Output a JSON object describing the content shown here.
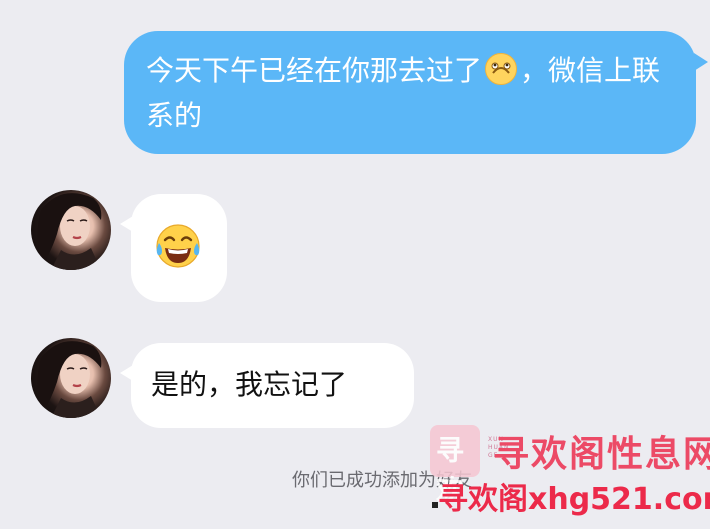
{
  "chat": {
    "outgoing": {
      "text_part1": "今天下午已经在你那去过了",
      "emoji": "upside-down-face",
      "text_part2": "，微信上联系的",
      "bubble_color": "#5bb7f7"
    },
    "incoming": [
      {
        "content_type": "emoji",
        "emoji": "tears-of-joy-face"
      },
      {
        "content_type": "text",
        "text": "是的，我忘记了"
      }
    ],
    "system_message": "你们已成功添加为好友"
  },
  "watermark": {
    "logo_text": "寻欢",
    "logo_sub": "XUN HUAN GE",
    "title": "寻欢阁性息网",
    "url": "寻欢阁xhg521.com",
    "color": "#ec4a66"
  },
  "colors": {
    "background": "#ececf1",
    "incoming_bubble": "#ffffff",
    "outgoing_bubble": "#5bb7f7"
  }
}
